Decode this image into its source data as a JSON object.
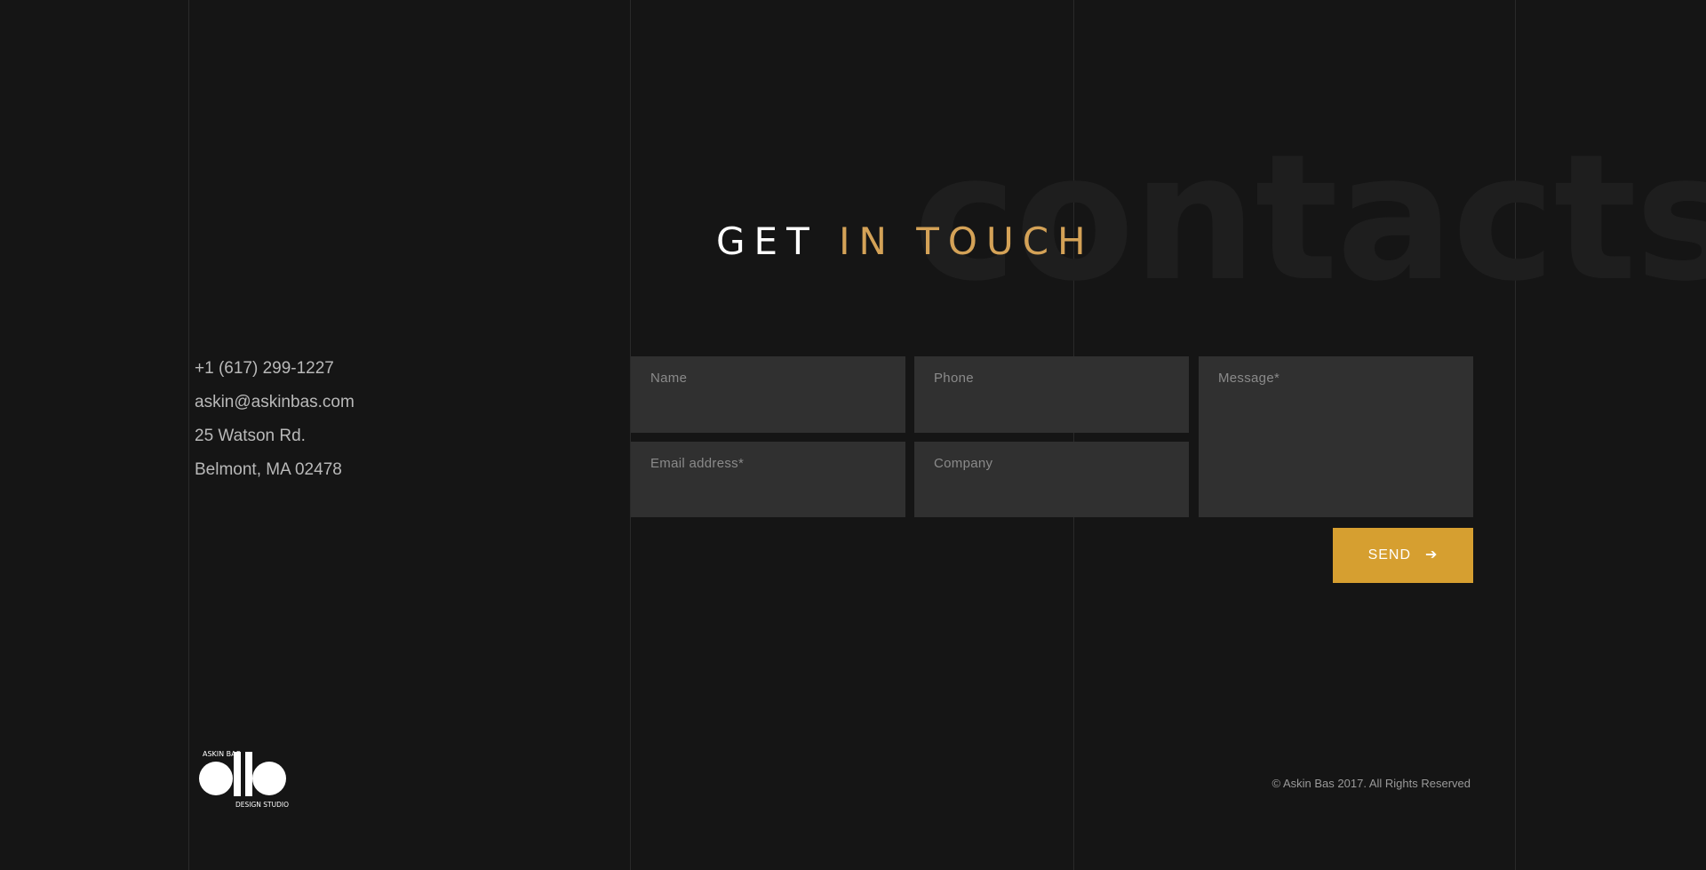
{
  "watermark": "contacts",
  "heading": {
    "part1": "GET ",
    "part2": "IN TOUCH"
  },
  "contact": {
    "phone": "+1 (617) 299-1227",
    "email": "askin@askinbas.com",
    "address1": "25 Watson Rd.",
    "address2": "Belmont, MA 02478"
  },
  "form": {
    "name_placeholder": "Name",
    "phone_placeholder": "Phone",
    "message_placeholder": "Message*",
    "email_placeholder": "Email address*",
    "company_placeholder": "Company",
    "send_label": "SEND",
    "send_icon": "arrow-right-icon"
  },
  "logo": {
    "top_text": "ASKIN BAS",
    "bottom_text": "DESIGN STUDIO"
  },
  "footer": {
    "copyright": "© Askin Bas 2017. All Rights Reserved"
  },
  "colors": {
    "background": "#151515",
    "accent": "#d4a257",
    "button": "#d69f30",
    "field": "#303030"
  }
}
